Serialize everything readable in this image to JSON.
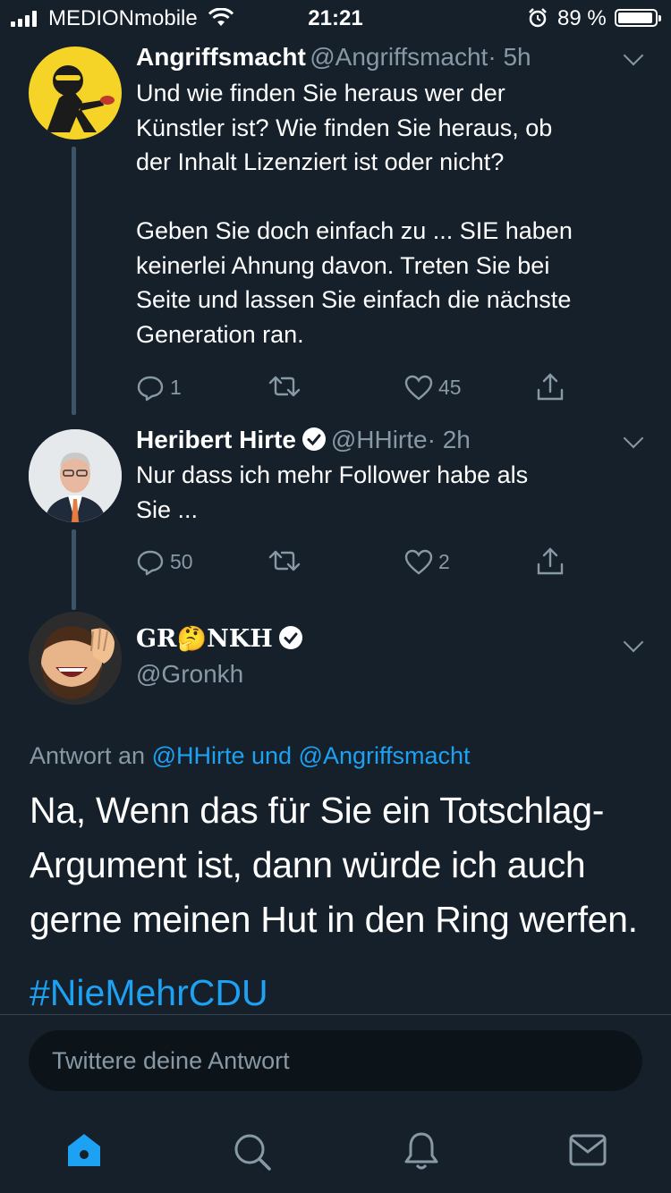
{
  "status_bar": {
    "carrier": "MEDIONmobile",
    "time": "21:21",
    "battery_percent": "89 %",
    "icons": [
      "signal-icon",
      "wifi-icon",
      "alarm-icon",
      "battery-icon"
    ]
  },
  "tweets": [
    {
      "name": "Angriffsmacht",
      "handle": "@Angriffsmacht",
      "time": "· 5h",
      "text": "Und wie finden Sie heraus wer der\nKünstler ist? Wie finden Sie heraus, ob\nder Inhalt Lizenziert ist oder nicht?\n\nGeben Sie doch einfach zu ... SIE haben\nkeinerlei Ahnung davon. Treten Sie bei\nSeite und lassen Sie einfach die nächste\nGeneration ran.",
      "replies": "1",
      "retweets": "",
      "likes": "45"
    },
    {
      "name": "Heribert Hirte",
      "handle": "@HHirte",
      "time": "· 2h",
      "text": "Nur dass ich mehr Follower habe als\nSie ...",
      "replies": "50",
      "retweets": "",
      "likes": "2"
    }
  ],
  "main_tweet": {
    "name": "GR🤔NKH",
    "handle": "@Gronkh",
    "reply_prefix": "Antwort an",
    "reply_users": "@HHirte und @Angriffsmacht",
    "text": "Na, Wenn das für Sie ein Totschlag-\nArgument ist, dann würde ich auch\ngerne meinen Hut in den Ring werfen.",
    "hashtag": "#NieMehrCDU"
  },
  "composer": {
    "placeholder": "Twittere deine Antwort"
  },
  "tabs": [
    "home-icon",
    "search-icon",
    "notifications-icon",
    "messages-icon"
  ],
  "colors": {
    "background": "#15202b",
    "accent": "#1da1f2",
    "secondary_text": "#8899a6",
    "avatar_yellow": "#f5d327"
  }
}
